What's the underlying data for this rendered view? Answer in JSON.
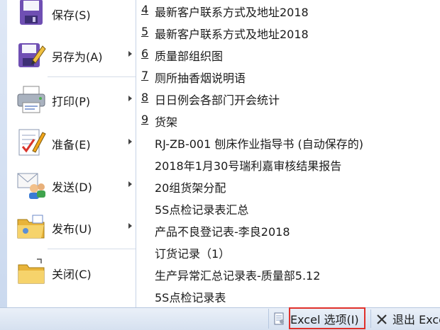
{
  "left_menu": [
    {
      "label": "保存(S)",
      "has_submenu": false,
      "icon": "save-icon"
    },
    {
      "label": "另存为(A)",
      "has_submenu": true,
      "icon": "save-as-icon"
    },
    {
      "label": "打印(P)",
      "has_submenu": true,
      "icon": "printer-icon"
    },
    {
      "label": "准备(E)",
      "has_submenu": true,
      "icon": "prepare-icon"
    },
    {
      "label": "发送(D)",
      "has_submenu": true,
      "icon": "send-icon"
    },
    {
      "label": "发布(U)",
      "has_submenu": true,
      "icon": "publish-icon"
    },
    {
      "label": "关闭(C)",
      "has_submenu": false,
      "icon": "close-folder-icon"
    }
  ],
  "recent_docs": [
    {
      "num": "4",
      "name": "最新客户联系方式及地址2018"
    },
    {
      "num": "5",
      "name": "最新客户联系方式及地址2018"
    },
    {
      "num": "6",
      "name": "质量部组织图"
    },
    {
      "num": "7",
      "name": "厕所抽香烟说明语"
    },
    {
      "num": "8",
      "name": "日日例会各部门开会统计"
    },
    {
      "num": "9",
      "name": "货架"
    },
    {
      "num": "",
      "name": "RJ-ZB-001 刨床作业指导书 (自动保存的)"
    },
    {
      "num": "",
      "name": "2018年1月30号瑞利嘉审核结果报告"
    },
    {
      "num": "",
      "name": "20组货架分配"
    },
    {
      "num": "",
      "name": "5S点检记录表汇总"
    },
    {
      "num": "",
      "name": "产品不良登记表-李良2018"
    },
    {
      "num": "",
      "name": "订货记录（1）"
    },
    {
      "num": "",
      "name": "生产异常汇总记录表-质量部5.12"
    },
    {
      "num": "",
      "name": "5S点检记录表"
    }
  ],
  "bottom": {
    "options_label": "Excel 选项(I)",
    "exit_label": "退出 Excel"
  },
  "colors": {
    "highlight": "#e0302a",
    "accent": "#c9d8ee"
  }
}
